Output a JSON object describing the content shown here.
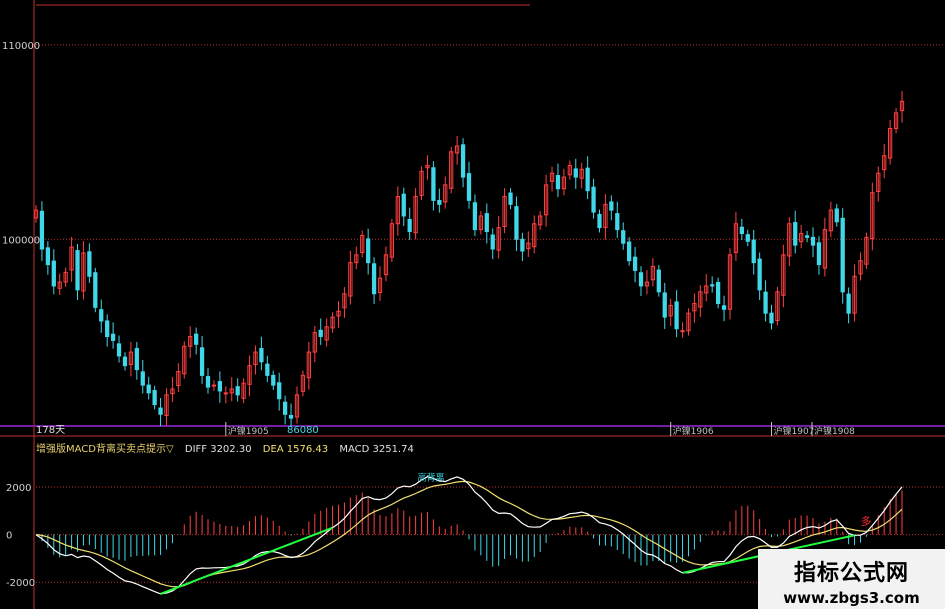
{
  "chart_data": [
    {
      "type": "candlestick",
      "axis": {
        "ylim": [
          90500,
          112000
        ],
        "ticks": [
          110000,
          100000
        ]
      },
      "period_label": "178天",
      "low_marker": "86080",
      "month_labels": [
        "沪镍1905",
        "沪镍1906",
        "沪镍1907",
        "沪镍1908"
      ],
      "closes": [
        101500,
        99500,
        98700,
        97600,
        97800,
        98300,
        99600,
        97400,
        99300,
        98100,
        96500,
        95800,
        95000,
        94800,
        94000,
        93500,
        94200,
        93300,
        92500,
        92100,
        91500,
        91000,
        92000,
        92300,
        93200,
        94500,
        95000,
        94600,
        93000,
        92400,
        92500,
        92200,
        92100,
        92300,
        92000,
        92600,
        93500,
        94200,
        93700,
        93000,
        92500,
        91800,
        91000,
        90800,
        92000,
        93000,
        94200,
        95200,
        95000,
        95500,
        96000,
        96300,
        97200,
        98800,
        99200,
        100200,
        98800,
        97200,
        98000,
        99200,
        100800,
        102200,
        101200,
        100400,
        102200,
        103500,
        103800,
        102000,
        101800,
        102800,
        104500,
        104800,
        103200,
        102000,
        100500,
        101200,
        100400,
        99500,
        100600,
        102200,
        101800,
        100000,
        99400,
        99800,
        100800,
        101200,
        102800,
        103400,
        102600,
        103200,
        103800,
        103200,
        103600,
        102500,
        101400,
        100600,
        101800,
        101500,
        100500,
        99800,
        98900,
        98400,
        97600,
        97800,
        98600,
        97300,
        96000,
        96600,
        95400,
        95300,
        96200,
        96700,
        97300,
        97600,
        97600,
        96700,
        96400,
        99200,
        100800,
        100300,
        99900,
        98800,
        97400,
        96200,
        95700,
        97300,
        99200,
        100800,
        99700,
        100300,
        100100,
        99700,
        98700,
        100500,
        101500,
        100900,
        97300,
        96200,
        98100,
        98900,
        100100,
        102400,
        103400,
        104300,
        105700,
        106500,
        107100
      ]
    },
    {
      "type": "macd",
      "indicator_name": "增强版MACD背离买卖点提示",
      "diff_label": "DIFF 3202.30",
      "dea_label": "DEA 1576.43",
      "macd_label": "MACD 3251.74",
      "axis": {
        "ylim": [
          -3000,
          3300
        ],
        "ticks": [
          2000,
          0,
          -2000
        ]
      },
      "cross_label": "高背离",
      "buy_label": "多"
    }
  ],
  "watermark": {
    "title": "指标公式网",
    "url": "www.zbgs3.com"
  },
  "colors": {
    "up": "#ff4040",
    "down": "#40d8e8",
    "diff": "#ffffff",
    "dea": "#f0e070",
    "grid": "#c03030",
    "divider": "#7020a0",
    "trend": "#20ff40"
  }
}
